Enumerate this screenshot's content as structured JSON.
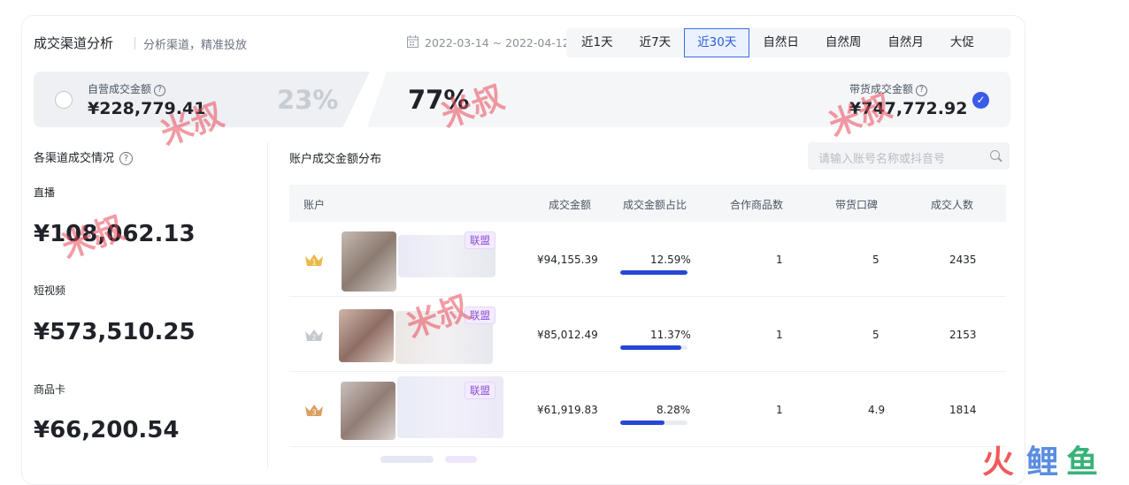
{
  "header": {
    "title": "成交渠道分析",
    "subtitle": "分析渠道，精准投放",
    "date_range": "2022-03-14 ~ 2022-04-12",
    "periods": [
      "近1天",
      "近7天",
      "近30天",
      "自然日",
      "自然周",
      "自然月",
      "大促"
    ],
    "active_period": "近30天"
  },
  "toggle": {
    "self_label": "自营成交金额",
    "self_value": "¥228,779.41",
    "self_pct": "23%",
    "carry_pct": "77%",
    "carry_label": "带货成交金额",
    "carry_value": "¥747,772.92",
    "help_glyph": "?",
    "check_glyph": "✓"
  },
  "channels": {
    "title": "各渠道成交情况",
    "items": [
      {
        "name": "直播",
        "value": "¥108,062.13"
      },
      {
        "name": "短视频",
        "value": "¥573,510.25"
      },
      {
        "name": "商品卡",
        "value": "¥66,200.54"
      }
    ]
  },
  "accounts": {
    "title": "账户成交金额分布",
    "search_placeholder": "请输入账号名称或抖音号",
    "columns": [
      "账户",
      "成交金额",
      "成交金额占比",
      "合作商品数",
      "带货口碑",
      "成交人数"
    ],
    "rows": [
      {
        "rank": "1",
        "tag": "联盟",
        "amount": "¥94,155.39",
        "pct": "12.59%",
        "pct_value": 0.1259,
        "products": "1",
        "rating": "5",
        "buyers": "2435"
      },
      {
        "rank": "2",
        "tag": "联盟",
        "amount": "¥85,012.49",
        "pct": "11.37%",
        "pct_value": 0.1137,
        "products": "1",
        "rating": "5",
        "buyers": "2153"
      },
      {
        "rank": "3",
        "tag": "联盟",
        "amount": "¥61,919.83",
        "pct": "8.28%",
        "pct_value": 0.0828,
        "products": "1",
        "rating": "4.9",
        "buyers": "1814"
      }
    ]
  },
  "watermarks": [
    "米叔",
    "米叔",
    "米叔",
    "米叔",
    "米叔"
  ],
  "logo": {
    "a": "火",
    "b": "鲤",
    "c": "鱼"
  },
  "colors": {
    "accent": "#3a5ce6",
    "bar": "#2447d6",
    "tag": "#8a4bd6"
  }
}
